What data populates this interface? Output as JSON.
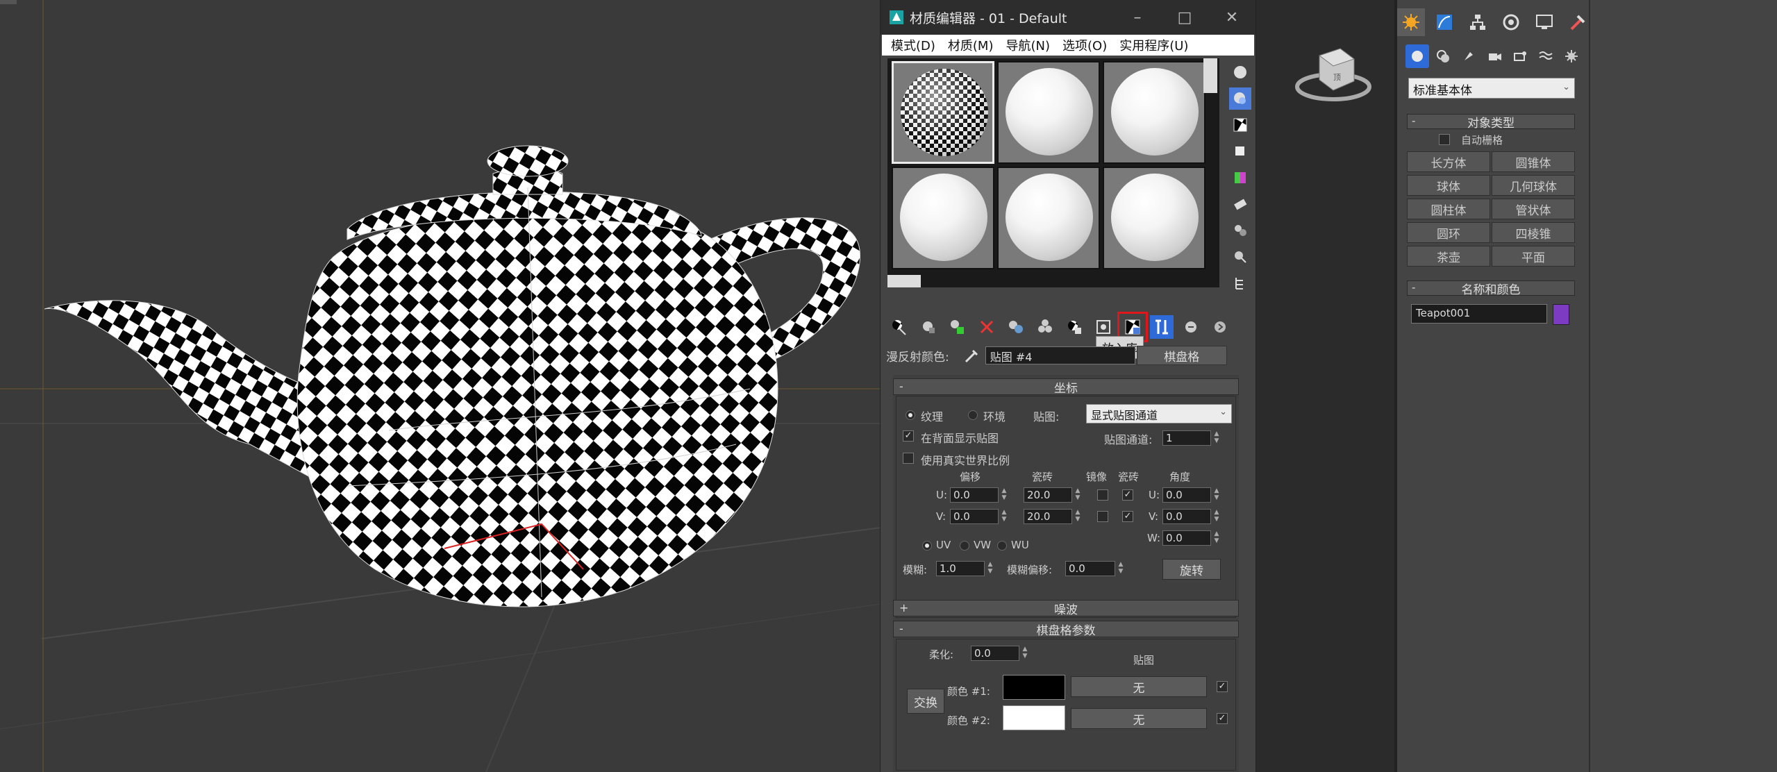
{
  "viewport": {
    "label": ""
  },
  "editor": {
    "title": "材质编辑器 - 01 - Default",
    "menu": [
      "模式(D)",
      "材质(M)",
      "导航(N)",
      "选项(O)",
      "实用程序(U)"
    ],
    "tooltip": "放入库",
    "diffuse_label": "漫反射颜色:",
    "map_name": "贴图 #4",
    "map_type": "棋盘格",
    "coords": {
      "title": "坐标",
      "texture": "纹理",
      "environ": "环境",
      "mapping_label": "贴图:",
      "mapping_value": "显式贴图通道",
      "show_back": "在背面显示贴图",
      "real_world": "使用真实世界比例",
      "map_channel_label": "贴图通道:",
      "map_channel": "1",
      "offset": "偏移",
      "tiling": "瓷砖",
      "mirror": "镜像",
      "tile": "瓷砖",
      "angle": "角度",
      "u_label": "U:",
      "v_label": "V:",
      "w_label": "W:",
      "u_offset": "0.0",
      "v_offset": "0.0",
      "u_tiling": "20.0",
      "v_tiling": "20.0",
      "u_angle": "0.0",
      "v_angle": "0.0",
      "w_angle": "0.0",
      "uv": "UV",
      "vw": "VW",
      "wu": "WU",
      "blur_label": "模糊:",
      "blur": "1.0",
      "blur_offset_label": "模糊偏移:",
      "blur_offset": "0.0",
      "rotate": "旋转"
    },
    "noise": {
      "title": "噪波"
    },
    "checker": {
      "title": "棋盘格参数",
      "soften_label": "柔化:",
      "soften": "0.0",
      "maps_label": "贴图",
      "swap": "交换",
      "color1_label": "颜色 #1:",
      "color2_label": "颜色 #2:",
      "map1": "无",
      "map2": "无",
      "color1": "#000000",
      "color2": "#ffffff"
    }
  },
  "command_panel": {
    "dropdown": "标准基本体",
    "object_type_title": "对象类型",
    "autogrid": "自动栅格",
    "buttons": [
      "长方体",
      "圆锥体",
      "球体",
      "几何球体",
      "圆柱体",
      "管状体",
      "圆环",
      "四棱锥",
      "茶壶",
      "平面"
    ],
    "name_color_title": "名称和颜色",
    "object_name": "Teapot001",
    "object_color": "#7d3ac2"
  }
}
